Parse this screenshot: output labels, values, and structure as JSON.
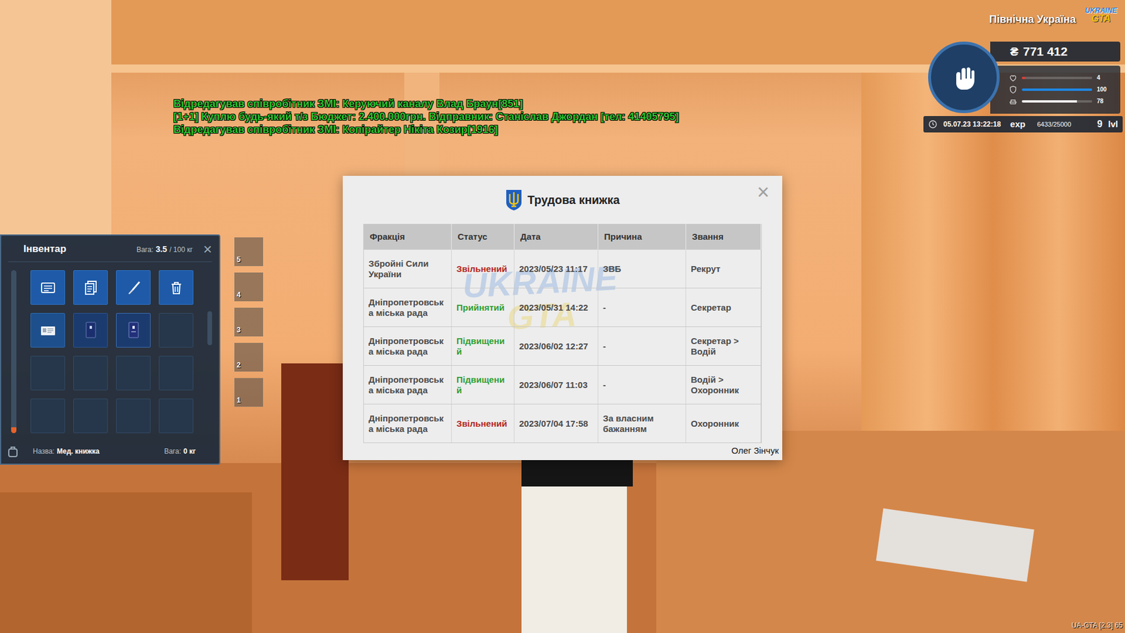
{
  "chat": [
    {
      "text": "Відредагував співробітник ЗМІ: Керуючий каналу Влад Браун[851]"
    },
    {
      "text": "[1+1] Куплю будь-який т/з Бюджет: 2.400.000грн. Відправник: Станіслав Джордан [тел: 41405795]"
    },
    {
      "text": "Відредагував співробітник ЗМІ: Копірайтер Нікіта Козир[1916]"
    }
  ],
  "hud": {
    "region": "Північна Україна",
    "logo_top": "UKRAINE",
    "logo_bottom": "GTA",
    "currency": "₴",
    "money": "771 412",
    "bars": [
      {
        "kind": "health",
        "value": "4",
        "level": 0.04,
        "color": "#e53935"
      },
      {
        "kind": "armor",
        "value": "100",
        "level": 1,
        "color": "#1e88e5"
      },
      {
        "kind": "hunger",
        "value": "78",
        "level": 0.78,
        "color": "#f2f2f2"
      }
    ],
    "datetime": "05.07.23 13:22:18",
    "exp_label": "exp",
    "exp": "6433/25000",
    "level": "9",
    "level_label": "lvl"
  },
  "inventory": {
    "title": "Інвентар",
    "weight_label": "Вага:",
    "weight": "3.5",
    "weight_max": "/ 100 кг",
    "close": "×",
    "weight_level": 0.035,
    "slots": [
      {
        "kind": "id-card"
      },
      {
        "kind": "documents"
      },
      {
        "kind": "knife"
      },
      {
        "kind": "trash"
      },
      {
        "kind": "license"
      },
      {
        "kind": "passport"
      },
      {
        "kind": "passport-alt"
      },
      {
        "kind": "empty"
      },
      {
        "kind": "empty"
      },
      {
        "kind": "empty"
      },
      {
        "kind": "empty"
      },
      {
        "kind": "empty"
      },
      {
        "kind": "empty"
      },
      {
        "kind": "empty"
      },
      {
        "kind": "empty"
      },
      {
        "kind": "empty"
      }
    ],
    "name_label": "Назва:",
    "name": "Мед. книжка",
    "item_weight_label": "Вага:",
    "item_weight": "0 кг"
  },
  "hotbar": [
    {
      "label": "5"
    },
    {
      "label": "4"
    },
    {
      "label": "3"
    },
    {
      "label": "2"
    },
    {
      "label": "1"
    }
  ],
  "dialog": {
    "title": "Трудова книжка",
    "close": "×",
    "columns": [
      "Фракція",
      "Статус",
      "Дата",
      "Причина",
      "Звання"
    ],
    "rows": [
      {
        "faction": "Збройні Сили України",
        "status": "Звільнений",
        "status_color": "#b3261e",
        "date": "2023/05/23 11:17",
        "reason": "ЗВБ",
        "rank": "Рекрут"
      },
      {
        "faction": "Дніпропетровська міська рада",
        "status": "Прийнятий",
        "status_color": "#2e9e2e",
        "date": "2023/05/31 14:22",
        "reason": "-",
        "rank": "Секретар"
      },
      {
        "faction": "Дніпропетровська міська рада",
        "status": "Підвищений",
        "status_color": "#2e9e2e",
        "date": "2023/06/02 12:27",
        "reason": "-",
        "rank": "Секретар > Водій"
      },
      {
        "faction": "Дніпропетровська міська рада",
        "status": "Підвищений",
        "status_color": "#2e9e2e",
        "date": "2023/06/07 11:03",
        "reason": "-",
        "rank": "Водій > Охоронник"
      },
      {
        "faction": "Дніпропетровська міська рада",
        "status": "Звільнений",
        "status_color": "#b3261e",
        "date": "2023/07/04 17:58",
        "reason": "За власним бажанням",
        "rank": "Охоронник"
      }
    ],
    "signature": "Олег Зінчук"
  },
  "version": "UA-GTA [2.3] 65"
}
